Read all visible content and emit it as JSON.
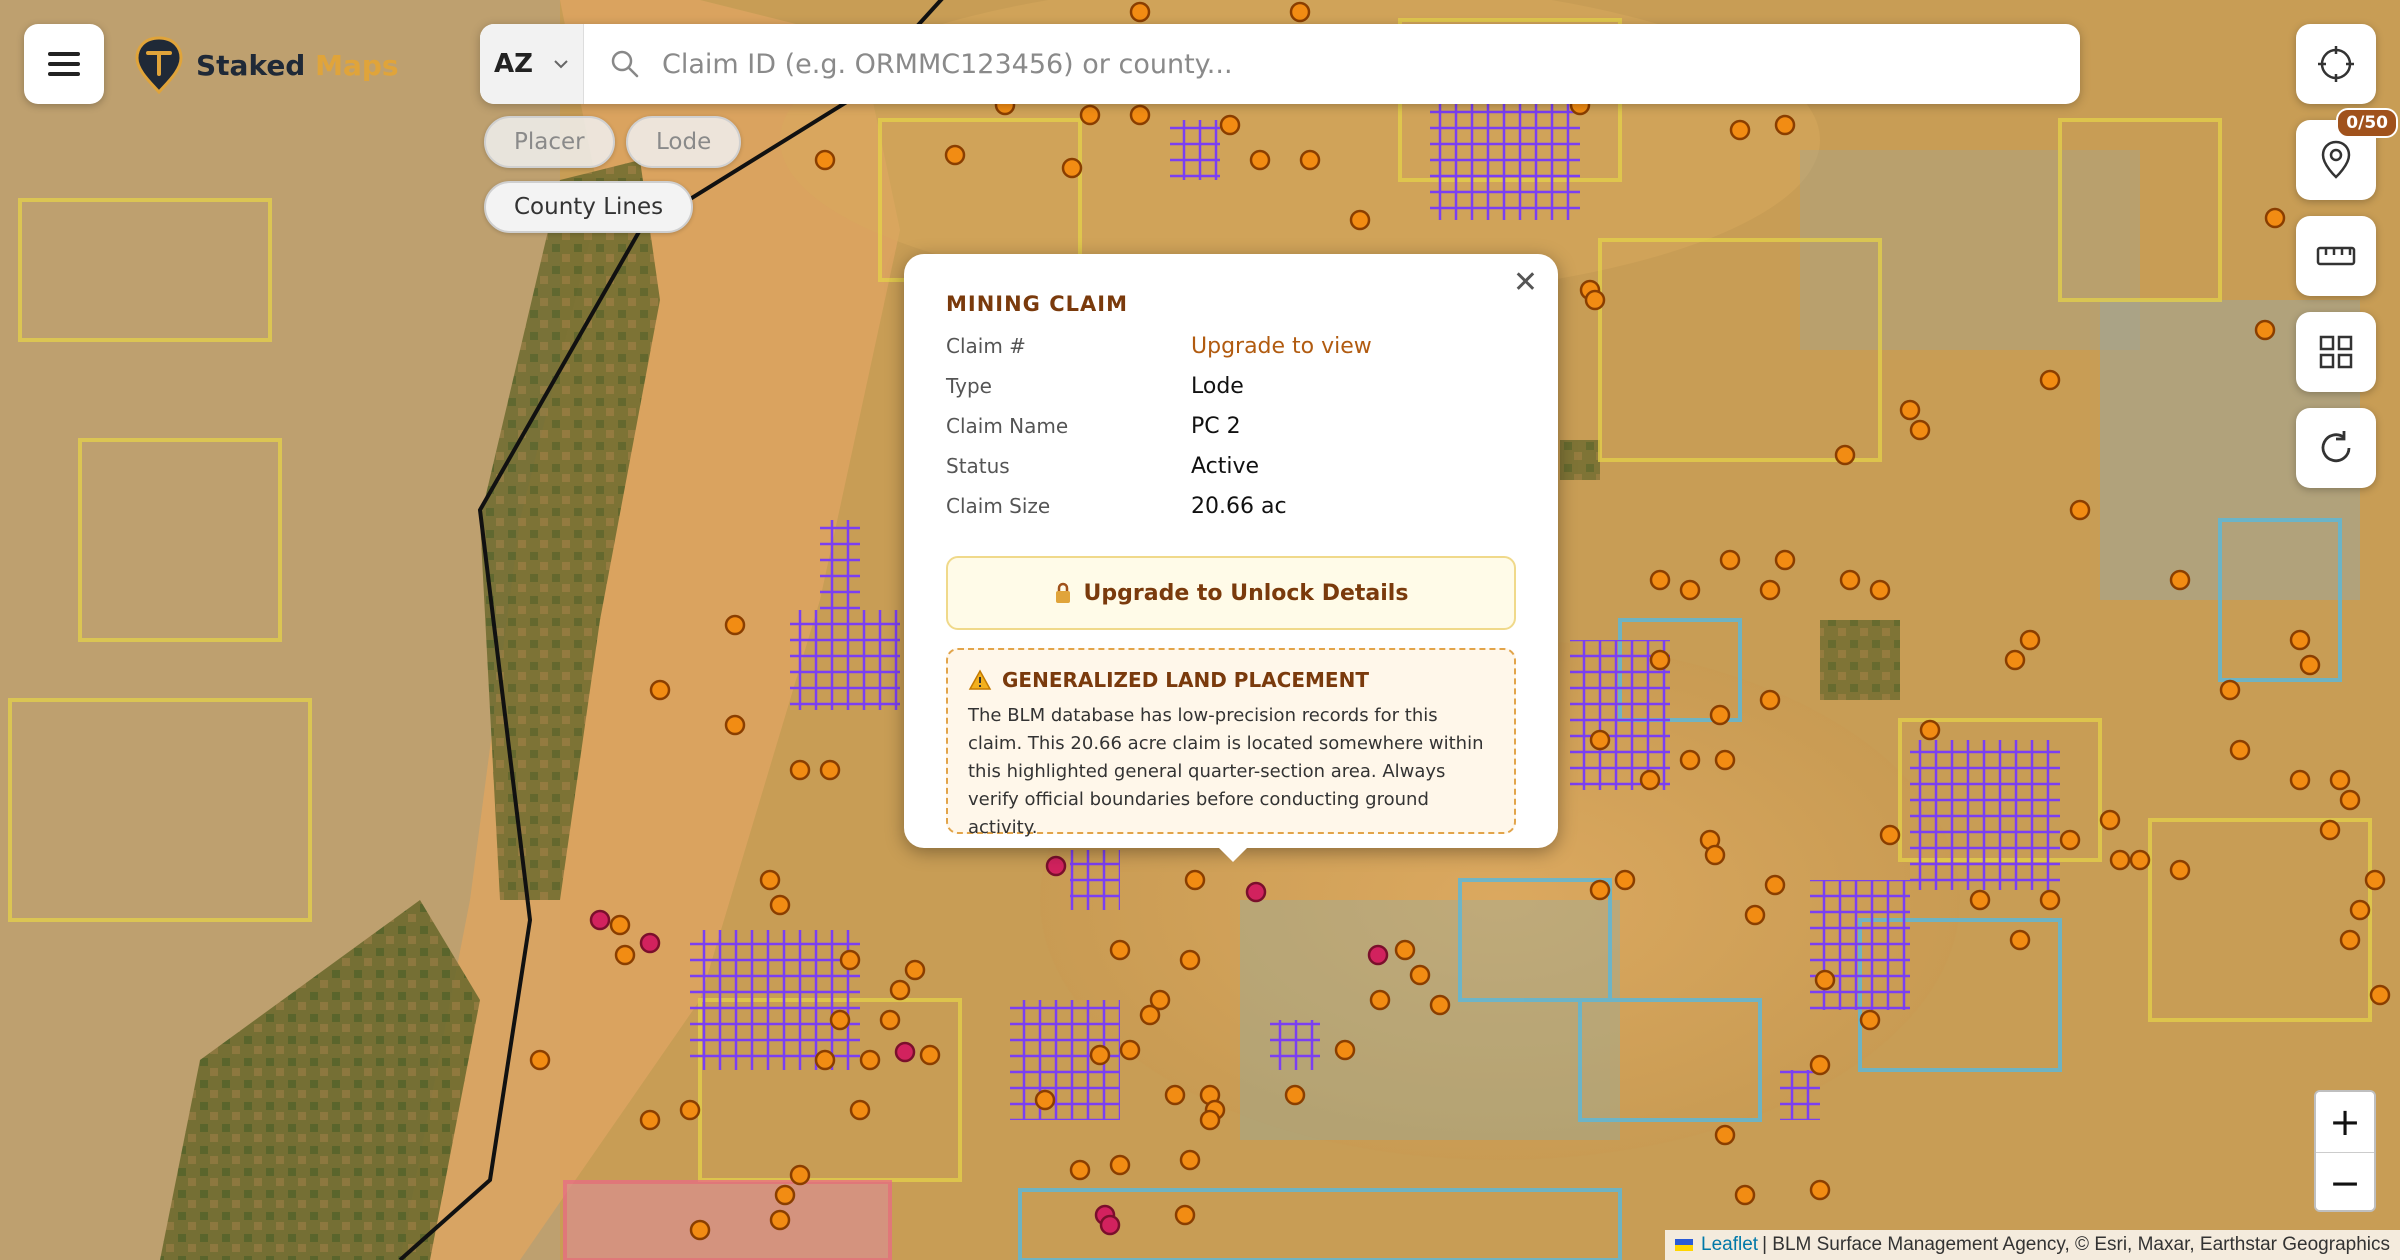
{
  "app": {
    "brand_primary": "Staked",
    "brand_accent": "Maps"
  },
  "search": {
    "state": "AZ",
    "placeholder": "Claim ID (e.g. ORMMC123456) or county..."
  },
  "filters": [
    {
      "label": "Placer",
      "active": false
    },
    {
      "label": "Lode",
      "active": false
    },
    {
      "label": "County Lines",
      "active": true
    }
  ],
  "toolbar": {
    "pin_badge": "0/50"
  },
  "popup": {
    "heading": "MINING CLAIM",
    "rows": [
      {
        "label": "Claim #",
        "value": "Upgrade to view"
      },
      {
        "label": "Type",
        "value": "Lode"
      },
      {
        "label": "Claim Name",
        "value": "PC 2"
      },
      {
        "label": "Status",
        "value": "Active"
      },
      {
        "label": "Claim Size",
        "value": "20.66 ac"
      }
    ],
    "upgrade_label": "Upgrade to Unlock Details",
    "warning_title": "GENERALIZED LAND PLACEMENT",
    "warning_text": "The BLM database has low-precision records for this claim. This 20.66 acre claim is located somewhere within this highlighted general quarter-section area. Always verify official boundaries before conducting ground activity."
  },
  "zoom": {
    "in": "+",
    "out": "−"
  },
  "attribution": {
    "leaflet": "Leaflet",
    "rest": "| BLM Surface Management Agency, © Esri, Maxar, Earthstar Geographics"
  },
  "colors": {
    "claim_lode": "#7b3ff2",
    "claim_placer": "#f28c13",
    "claim_closed": "#d2225e",
    "blm_land": "#e4d24a",
    "state_land": "#5fb7d6",
    "brand": "#e0a43a"
  },
  "icons": [
    "menu-icon",
    "logo-icon",
    "chevron-down-icon",
    "search-icon",
    "crosshair-icon",
    "pin-icon",
    "ruler-icon",
    "layers-icon",
    "refresh-icon",
    "close-icon",
    "lock-icon",
    "warning-icon"
  ]
}
